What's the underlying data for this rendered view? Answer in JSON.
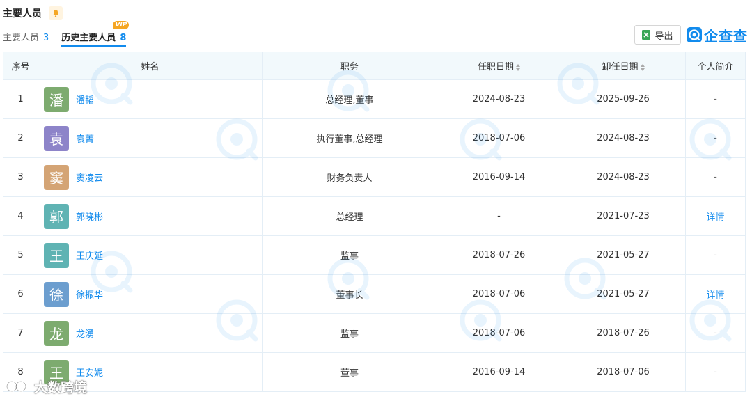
{
  "section": {
    "title": "主要人员",
    "bell_icon": "bell-icon"
  },
  "tabs": [
    {
      "label": "主要人员",
      "count": "3",
      "active": false
    },
    {
      "label": "历史主要人员",
      "count": "8",
      "active": true,
      "badge": "VIP"
    }
  ],
  "toolbar": {
    "export_label": "导出",
    "export_icon": "excel-icon"
  },
  "brand": {
    "name": "企查查",
    "accent": "#128bed"
  },
  "table": {
    "headers": {
      "index": "序号",
      "name": "姓名",
      "position": "职务",
      "start_date": "任职日期",
      "end_date": "卸任日期",
      "bio": "个人简介"
    },
    "rows": [
      {
        "index": "1",
        "avatar_char": "潘",
        "avatar_color": "#7dab6f",
        "name": "潘韬",
        "position": "总经理,董事",
        "start": "2024-08-23",
        "end": "2025-09-26",
        "bio": "-"
      },
      {
        "index": "2",
        "avatar_char": "袁",
        "avatar_color": "#8d84c9",
        "name": "袁菁",
        "position": "执行董事,总经理",
        "start": "2018-07-06",
        "end": "2024-08-23",
        "bio": "-"
      },
      {
        "index": "3",
        "avatar_char": "窦",
        "avatar_color": "#d4a475",
        "name": "窦凌云",
        "position": "财务负责人",
        "start": "2016-09-14",
        "end": "2024-08-23",
        "bio": "-"
      },
      {
        "index": "4",
        "avatar_char": "郭",
        "avatar_color": "#5fb3b3",
        "name": "郭晓彬",
        "position": "总经理",
        "start": "-",
        "end": "2021-07-23",
        "bio": "详情"
      },
      {
        "index": "5",
        "avatar_char": "王",
        "avatar_color": "#5fb3b3",
        "name": "王庆延",
        "position": "监事",
        "start": "2018-07-26",
        "end": "2021-05-27",
        "bio": "-"
      },
      {
        "index": "6",
        "avatar_char": "徐",
        "avatar_color": "#6c9ecf",
        "name": "徐振华",
        "position": "董事长",
        "start": "2018-07-06",
        "end": "2021-05-27",
        "bio": "详情"
      },
      {
        "index": "7",
        "avatar_char": "龙",
        "avatar_color": "#7dab6f",
        "name": "龙湧",
        "position": "监事",
        "start": "2018-07-06",
        "end": "2018-07-26",
        "bio": "-"
      },
      {
        "index": "8",
        "avatar_char": "王",
        "avatar_color": "#7dab6f",
        "name": "王安妮",
        "position": "董事",
        "start": "2016-09-14",
        "end": "2018-07-06",
        "bio": "-"
      }
    ]
  },
  "footer_watermark": {
    "text": "大数跨境"
  }
}
